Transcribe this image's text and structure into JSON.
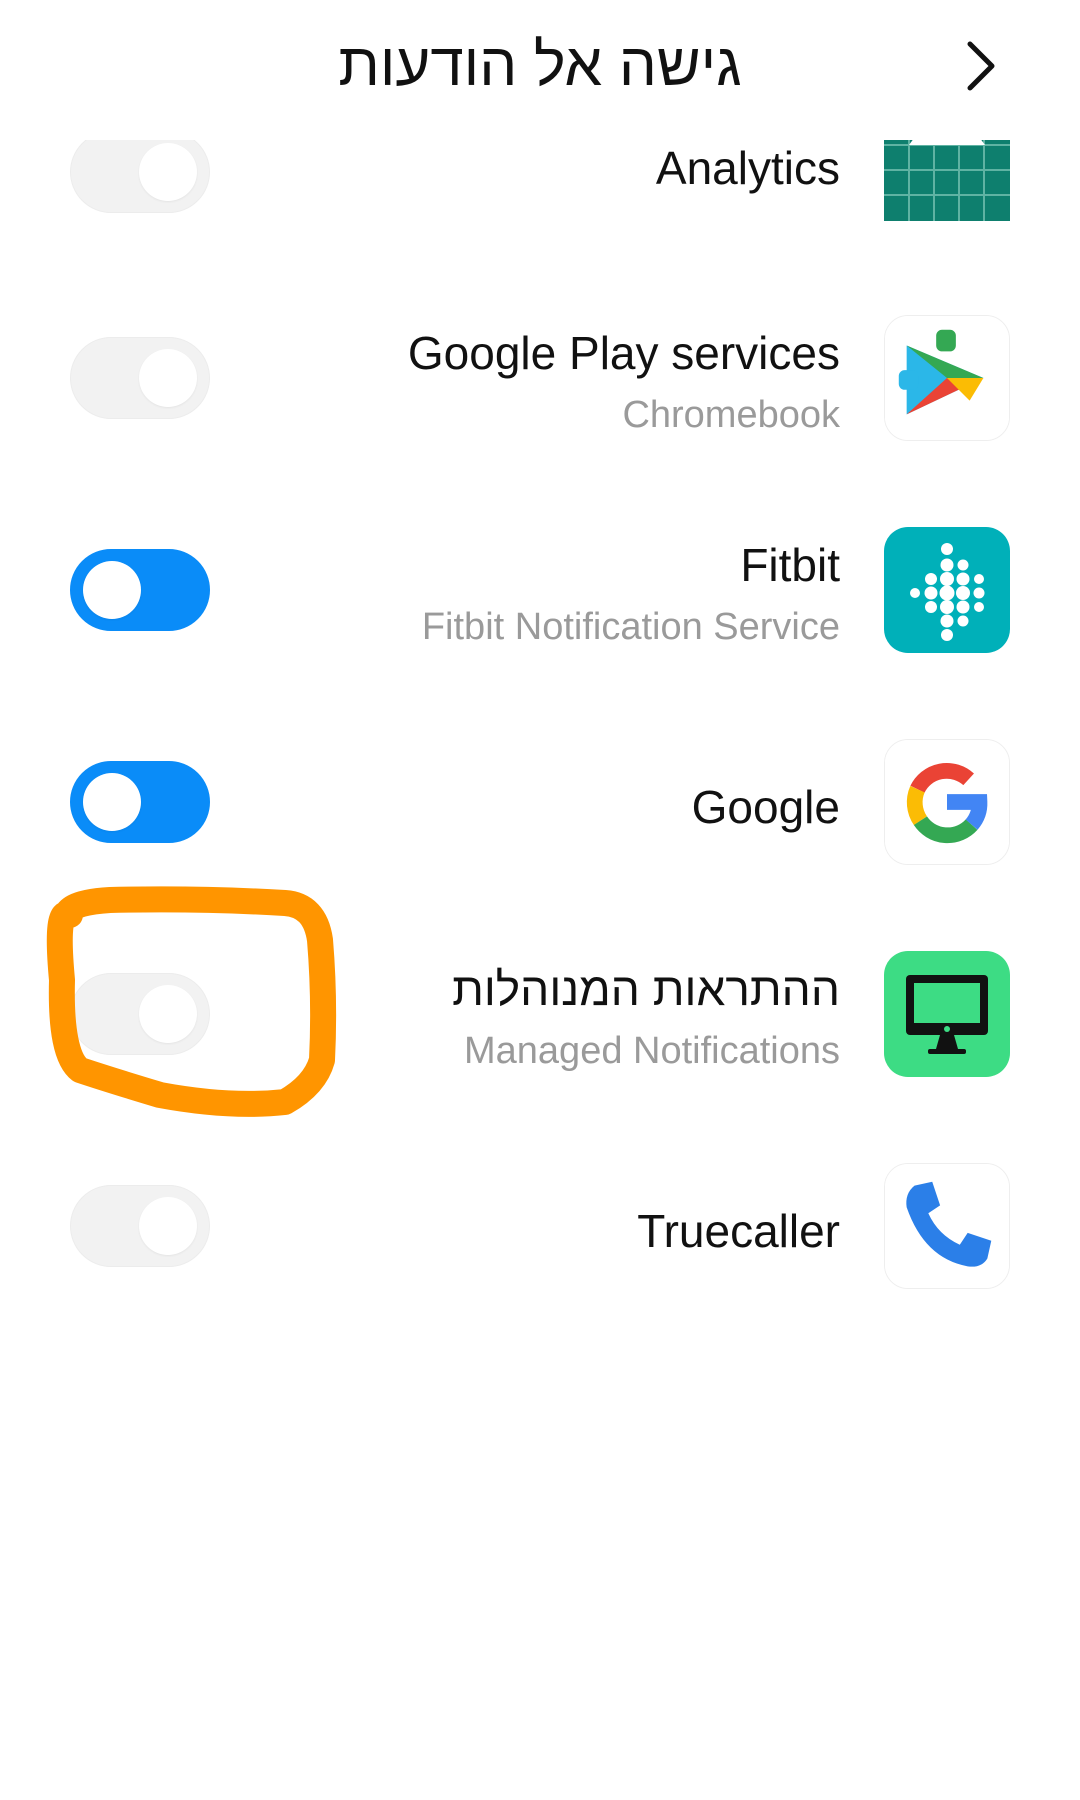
{
  "header": {
    "title": "גישה אל הודעות",
    "back_icon": "chevron-right-icon"
  },
  "apps": [
    {
      "name": "Analytics",
      "subtitle": "",
      "enabled": false,
      "icon": "android-analytics-icon"
    },
    {
      "name": "Google Play services",
      "subtitle": "Chromebook",
      "enabled": false,
      "icon": "google-play-services-icon"
    },
    {
      "name": "Fitbit",
      "subtitle": "Fitbit Notification Service",
      "enabled": true,
      "icon": "fitbit-icon"
    },
    {
      "name": "Google",
      "subtitle": "",
      "enabled": true,
      "icon": "google-g-icon"
    },
    {
      "name": "ההתראות המנוהלות",
      "subtitle": "Managed Notifications",
      "enabled": false,
      "icon": "monitor-icon"
    },
    {
      "name": "Truecaller",
      "subtitle": "",
      "enabled": false,
      "icon": "phone-icon"
    }
  ],
  "colors": {
    "toggle_on": "#0a8cf8",
    "toggle_off": "#f2f2f2",
    "annotation": "#ff9500"
  }
}
